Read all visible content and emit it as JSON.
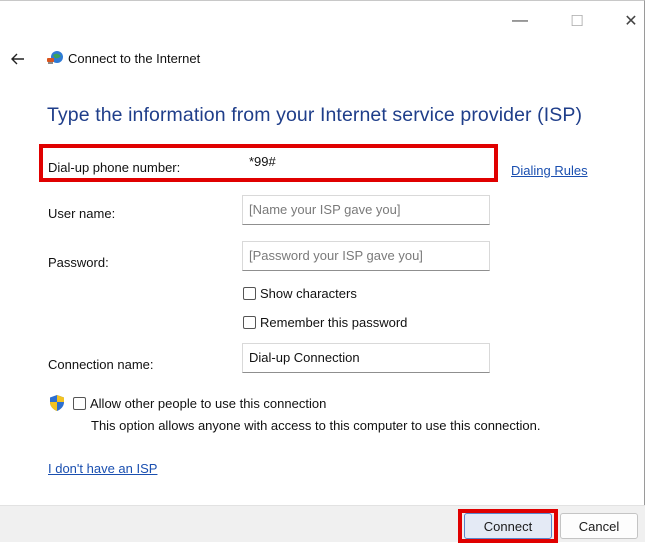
{
  "window": {
    "title": "Connect to the Internet",
    "controls": {
      "minimize": "—",
      "maximize": "☐",
      "close": "✕"
    }
  },
  "form": {
    "heading": "Type the information from your Internet service provider (ISP)",
    "phone": {
      "label": "Dial-up phone number:",
      "value": "*99#"
    },
    "dialing_rules": "Dialing Rules",
    "username": {
      "label": "User name:",
      "placeholder": "[Name your ISP gave you]"
    },
    "password": {
      "label": "Password:",
      "placeholder": "[Password your ISP gave you]"
    },
    "show_characters": "Show characters",
    "remember_password": "Remember this password",
    "connection_name": {
      "label": "Connection name:",
      "value": "Dial-up Connection"
    },
    "allow_others": "Allow other people to use this connection",
    "allow_others_desc": "This option allows anyone with access to this computer to use this connection.",
    "no_isp_link": "I don't have an ISP"
  },
  "footer": {
    "connect": "Connect",
    "cancel": "Cancel"
  },
  "colors": {
    "heading": "#1f3e8a",
    "link": "#1a4fb0",
    "highlight": "#e00000",
    "footer_bg": "#f0f0f0"
  }
}
